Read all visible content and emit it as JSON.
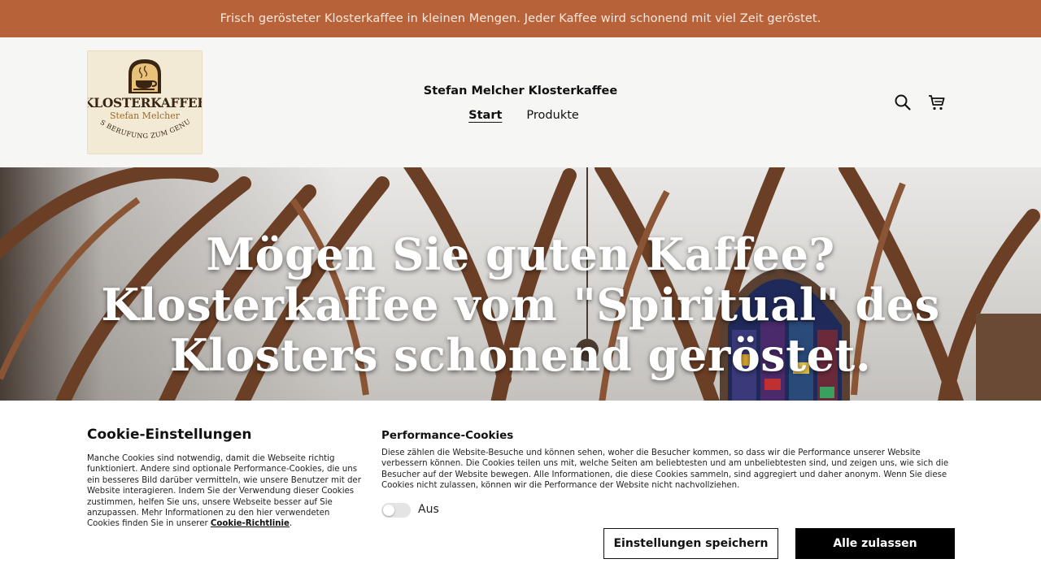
{
  "announcement": "Frisch gerösteter Klosterkaffee in kleinen Mengen. Jeder Kaffee wird schonend mit viel Zeit geröstet.",
  "header": {
    "logo": {
      "title": "KLOSTERKAFFEE",
      "subtitle": "Stefan Melcher",
      "tagline": "AUS BERUFUNG ZUM GENUSS"
    },
    "brand_title": "Stefan Melcher Klosterkaffee",
    "nav": [
      {
        "label": "Start",
        "active": true
      },
      {
        "label": "Produkte",
        "active": false
      }
    ],
    "icons": [
      "search-icon",
      "cart-icon"
    ]
  },
  "hero": {
    "heading": "Mögen Sie guten Kaffee? Klosterkaffee vom \"Spiritual\" des Klosters schonend geröstet."
  },
  "cookie_banner": {
    "title": "Cookie-Einstellungen",
    "text": "Manche Cookies sind notwendig, damit die Webseite richtig funktioniert. Andere sind optionale Performance-Cookies, die uns ein besseres Bild darüber vermitteln, wie unsere Benutzer mit der Website interagieren. Indem Sie der Verwendung dieser Cookies zustimmen, helfen Sie uns, unsere Webseite besser auf Sie anzupassen. Mehr Informationen zu den hier verwendeten Cookies finden Sie in unserer ",
    "policy_link": "Cookie-Richtlinie",
    "text_end": ".",
    "performance_title": "Performance-Cookies",
    "performance_text": "Diese zählen die Website-Besuche und können sehen, woher die Besucher kommen, so dass wir die Performance unserer Website verbessern können. Die Cookies teilen uns mit, welche Seiten am beliebtesten und am unbeliebtesten sind, und zeigen uns, wie sich die Besucher auf der Website bewegen. Alle Informationen, die diese Cookies sammeln, sind aggregiert und daher anonym. Wenn Sie diese Cookies nicht zulassen, können wir die Performance der Website nicht nachvollziehen.",
    "toggle_label": "Aus",
    "toggle_on": false,
    "save_button": "Einstellungen speichern",
    "allow_all_button": "Alle zulassen"
  },
  "colors": {
    "announcement_bg": "#b8623a",
    "header_bg": "#f6f6f5",
    "button_primary_bg": "#000000"
  }
}
